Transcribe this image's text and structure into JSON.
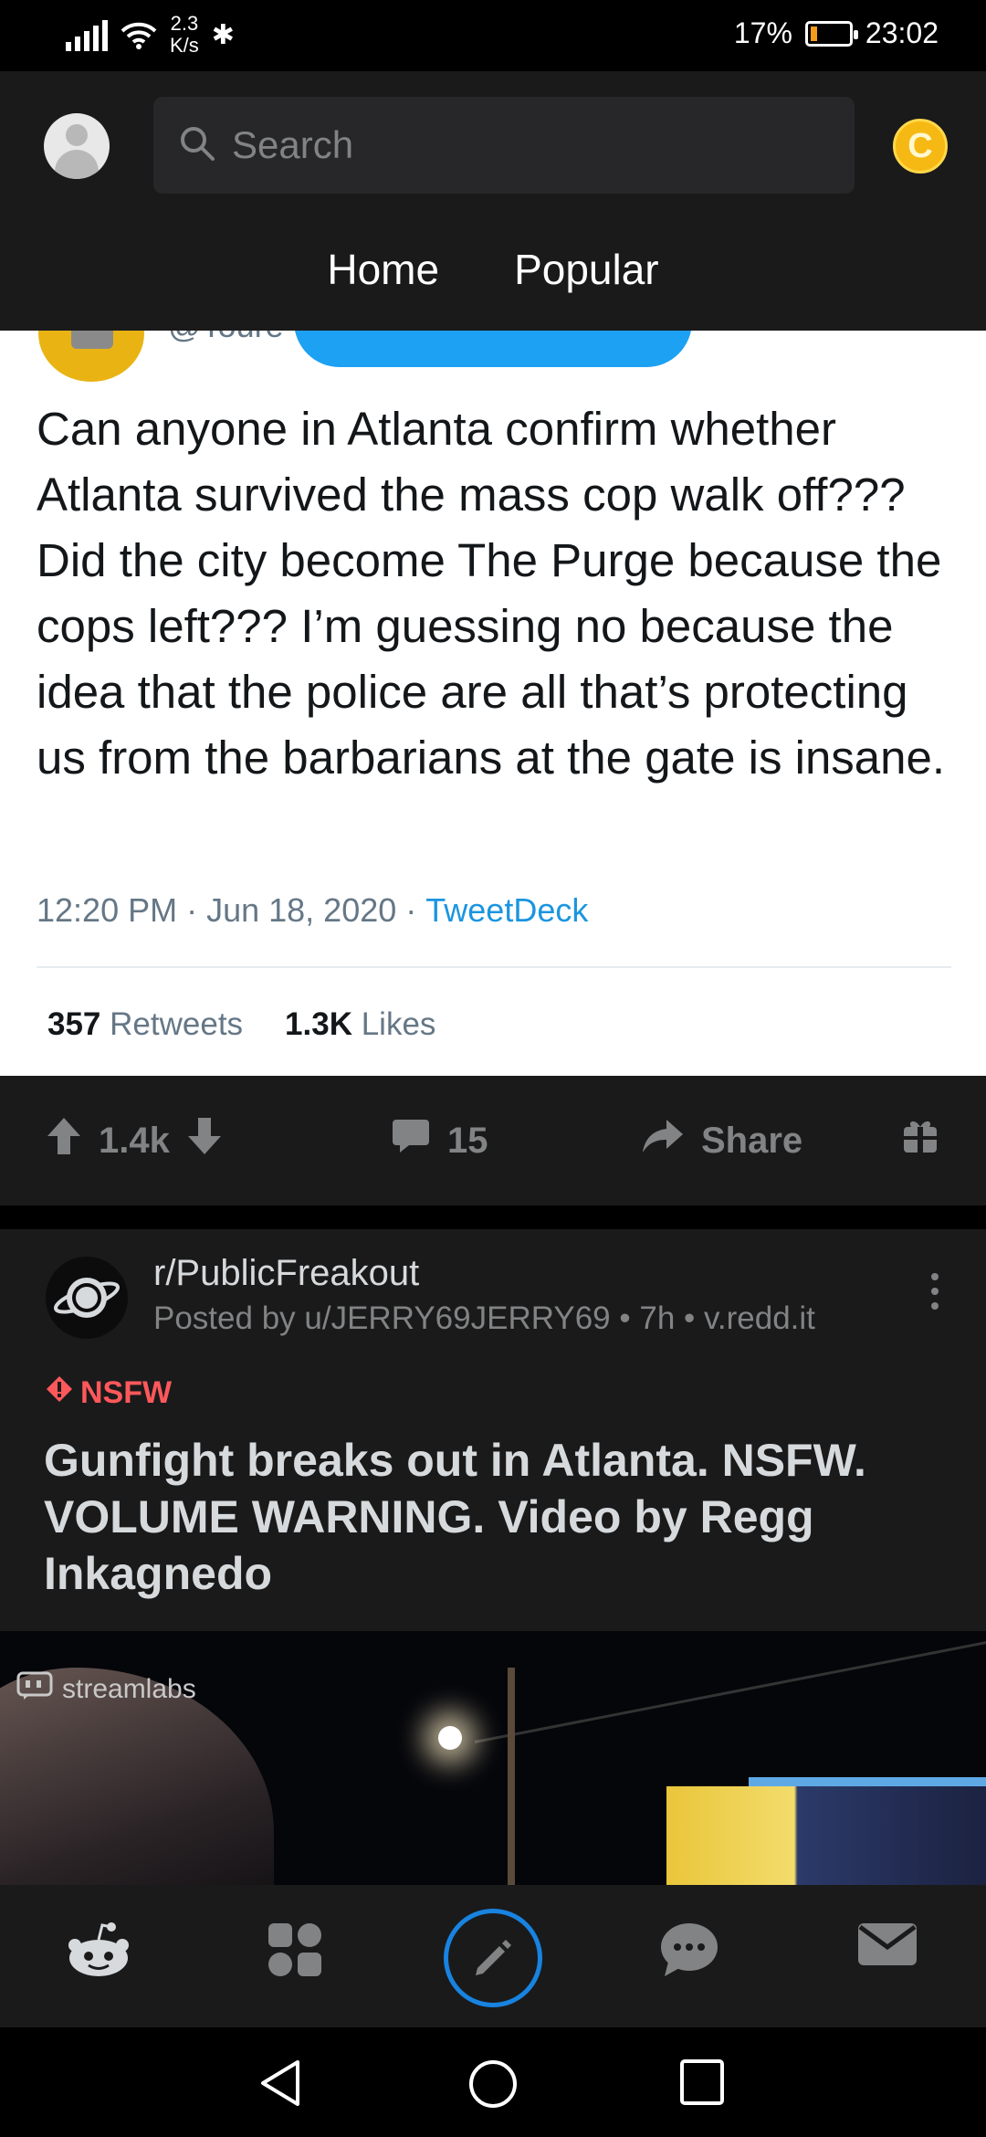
{
  "status_bar": {
    "net_speed_value": "2.3",
    "net_speed_unit": "K/s",
    "battery": "17%",
    "battery_level": 0.17,
    "time": "23:02"
  },
  "header": {
    "search_placeholder": "Search",
    "tabs": [
      "Home",
      "Popular"
    ]
  },
  "tweet": {
    "handle": "@Toure",
    "text": "Can anyone in Atlanta confirm whether Atlanta survived the mass cop walk off??? Did the city become The Purge because the cops left??? I’m guessing no because the idea that the police are all that’s protecting us from the barbarians at the gate is insane.",
    "time": "12:20 PM",
    "date": "Jun 18, 2020",
    "source": "TweetDeck",
    "retweets_count": "357",
    "retweets_label": "Retweets",
    "likes_count": "1.3K",
    "likes_label": "Likes"
  },
  "post_actions": {
    "votes": "1.4k",
    "comments": "15",
    "share_label": "Share",
    "icons": [
      "upvote-icon",
      "downvote-icon",
      "comment-icon",
      "share-icon",
      "award-icon"
    ]
  },
  "post": {
    "subreddit": "r/PublicFreakout",
    "meta": "Posted by u/JERRY69JERRY69 • 7h • v.redd.it",
    "nsfw_label": "NSFW",
    "title": "Gunfight breaks out in Atlanta. NSFW. VOLUME WARNING. Video by Regg Inkagnedo",
    "watermark": "streamlabs"
  },
  "bottom_nav": {
    "icons": [
      "home-icon",
      "communities-icon",
      "create-post-icon",
      "chat-icon",
      "inbox-icon"
    ]
  },
  "colors": {
    "accent_blue": "#1883e0",
    "nsfw_red": "#ff585b",
    "coin_gold": "#f6b914",
    "twitter_blue": "#1da1f2",
    "link_blue": "#1b95e0"
  }
}
